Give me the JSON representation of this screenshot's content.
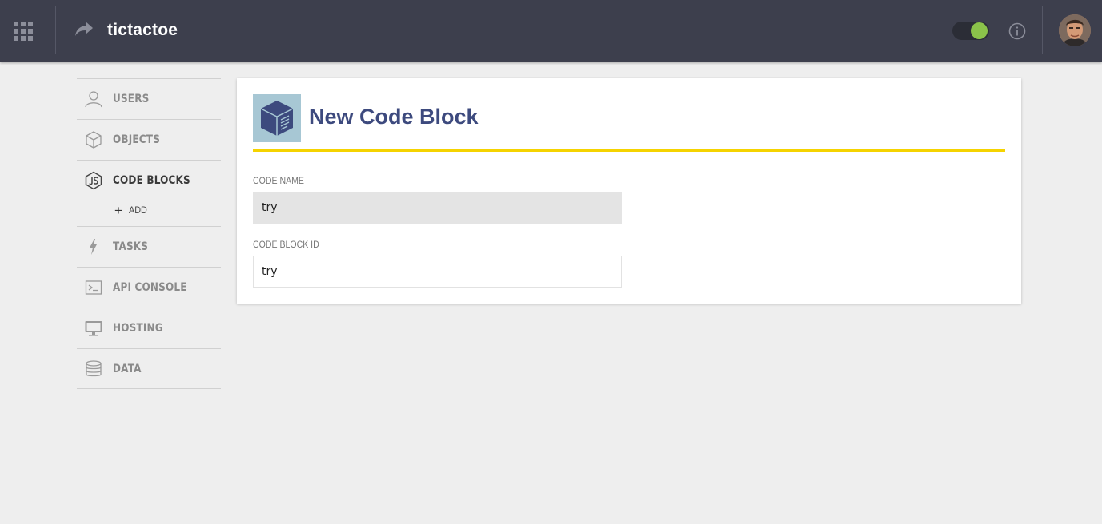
{
  "header": {
    "apps_icon": "apps-grid-icon",
    "share_icon": "share-arrow-icon",
    "app_title": "tictactoe",
    "toggle_on": true,
    "toggle_color": "#8bc34a",
    "info_icon": "info-icon",
    "avatar_icon": "user-avatar"
  },
  "sidebar": {
    "items": [
      {
        "label": "USERS",
        "icon": "user-icon"
      },
      {
        "label": "OBJECTS",
        "icon": "cube-icon"
      },
      {
        "label": "CODE BLOCKS",
        "icon": "js-icon",
        "active": true,
        "sub_add": "ADD"
      },
      {
        "label": "TASKS",
        "icon": "lightning-icon"
      },
      {
        "label": "API CONSOLE",
        "icon": "terminal-icon"
      },
      {
        "label": "HOSTING",
        "icon": "monitor-icon"
      },
      {
        "label": "DATA",
        "icon": "database-icon"
      }
    ]
  },
  "main": {
    "title": "New Code Block",
    "accent_color": "#f5d300",
    "title_color": "#3d4a7e",
    "fields": [
      {
        "label": "CODE NAME",
        "value": "try"
      },
      {
        "label": "CODE BLOCK ID",
        "value": "try"
      }
    ]
  }
}
